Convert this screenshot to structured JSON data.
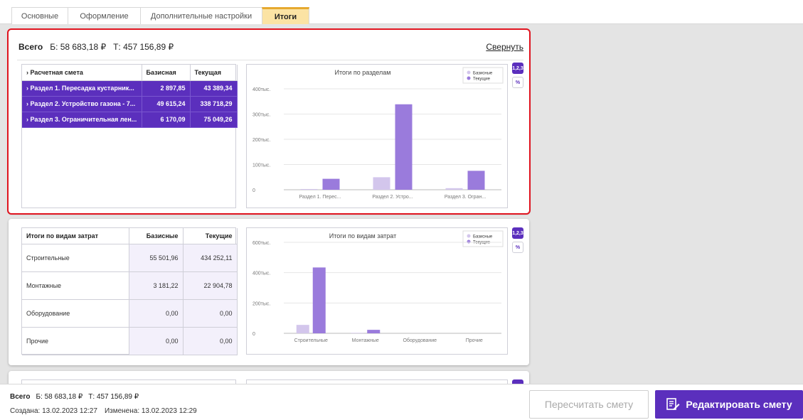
{
  "tabs": [
    {
      "label": "Основные"
    },
    {
      "label": "Оформление"
    },
    {
      "label": "Дополнительные настройки"
    },
    {
      "label": "Итоги",
      "active": true
    }
  ],
  "summary_card": {
    "title": "Всего",
    "basic": "Б: 58 683,18 ₽",
    "current": "Т: 457 156,89 ₽",
    "collapse_label": "Свернуть",
    "table": {
      "headers": [
        "Расчетная смета",
        "Базисная",
        "Текущая"
      ],
      "rows": [
        {
          "name": "Раздел 1. Пересадка кустарник...",
          "basic": "2 897,85",
          "current": "43 389,34"
        },
        {
          "name": "Раздел 2. Устройство газона - 7...",
          "basic": "49 615,24",
          "current": "338 718,29"
        },
        {
          "name": "Раздел 3. Ограничительная лен...",
          "basic": "6 170,09",
          "current": "75 049,26"
        }
      ]
    },
    "side_buttons": [
      "1,2,3",
      "%"
    ]
  },
  "costs_card": {
    "table": {
      "headers": [
        "Итоги по видам затрат",
        "Базисные",
        "Текущие"
      ],
      "rows": [
        {
          "name": "Строительные",
          "basic": "55 501,96",
          "current": "434 252,11"
        },
        {
          "name": "Монтажные",
          "basic": "3 181,22",
          "current": "22 904,78"
        },
        {
          "name": "Оборудование",
          "basic": "0,00",
          "current": "0,00"
        },
        {
          "name": "Прочие",
          "basic": "0,00",
          "current": "0,00"
        }
      ]
    },
    "side_buttons": [
      "1,2,3",
      "%"
    ]
  },
  "chart_data": [
    {
      "type": "bar",
      "title": "Итоги по разделам",
      "categories": [
        "Раздел 1. Перес...",
        "Раздел 2. Устро...",
        "Раздел 3. Огран..."
      ],
      "series": [
        {
          "name": "Базисные",
          "values": [
            2897.85,
            49615.24,
            6170.09
          ],
          "color": "#d3c6ec"
        },
        {
          "name": "Текущие",
          "values": [
            43389.34,
            338718.29,
            75049.26
          ],
          "color": "#9a7bdc"
        }
      ],
      "yticks": [
        {
          "value": 0,
          "label": "0"
        },
        {
          "value": 100000,
          "label": "100тыс."
        },
        {
          "value": 200000,
          "label": "200тыс."
        },
        {
          "value": 300000,
          "label": "300тыс."
        },
        {
          "value": 400000,
          "label": "400тыс."
        }
      ],
      "ylim": [
        0,
        400000
      ],
      "legend": "top-right",
      "grid": true
    },
    {
      "type": "bar",
      "title": "Итоги по видам затрат",
      "categories": [
        "Строительные",
        "Монтажные",
        "Оборудование",
        "Прочие"
      ],
      "series": [
        {
          "name": "Базисные",
          "values": [
            55501.96,
            3181.22,
            0,
            0
          ],
          "color": "#d3c6ec"
        },
        {
          "name": "Текущие",
          "values": [
            434252.11,
            22904.78,
            0,
            0
          ],
          "color": "#9a7bdc"
        }
      ],
      "yticks": [
        {
          "value": 0,
          "label": "0"
        },
        {
          "value": 200000,
          "label": "200тыс."
        },
        {
          "value": 400000,
          "label": "400тыс."
        },
        {
          "value": 600000,
          "label": "600тыс."
        }
      ],
      "ylim": [
        0,
        600000
      ],
      "legend": "top-right",
      "grid": true
    }
  ],
  "footer": {
    "title": "Всего",
    "basic": "Б: 58 683,18 ₽",
    "current": "Т: 457 156,89 ₽",
    "created": "Создана: 13.02.2023 12:27",
    "modified": "Изменена: 13.02.2023 12:29",
    "recalc_label": "Пересчитать смету",
    "edit_label": "Редактировать смету"
  },
  "colors": {
    "accent": "#5b2fbd",
    "highlight": "#e0141f",
    "tab_active": "#fbe3a4"
  }
}
